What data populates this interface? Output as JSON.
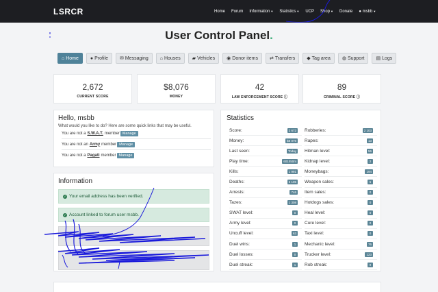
{
  "brand": "LSRCR",
  "nav": {
    "items": [
      {
        "label": "Home",
        "caret": false
      },
      {
        "label": "Forum",
        "caret": false
      },
      {
        "label": "Information",
        "caret": true
      },
      {
        "label": "Statistics",
        "caret": true
      },
      {
        "label": "UCP",
        "caret": false
      },
      {
        "label": "Shop",
        "caret": true
      },
      {
        "label": "Donate",
        "caret": false
      },
      {
        "label": "msbb",
        "caret": true
      }
    ]
  },
  "page_title": "User Control Panel",
  "page_title_dot": ".",
  "tabs": [
    {
      "label": "Home",
      "icon": "home-icon",
      "glyph": "⌂"
    },
    {
      "label": "Profile",
      "icon": "user-icon",
      "glyph": "●"
    },
    {
      "label": "Messaging",
      "icon": "envelope-icon",
      "glyph": "✉"
    },
    {
      "label": "Houses",
      "icon": "house-icon",
      "glyph": "⌂"
    },
    {
      "label": "Vehicles",
      "icon": "car-icon",
      "glyph": "▰"
    },
    {
      "label": "Donor items",
      "icon": "car-side-icon",
      "glyph": "◉"
    },
    {
      "label": "Transfers",
      "icon": "exchange-icon",
      "glyph": "⇄"
    },
    {
      "label": "Tag area",
      "icon": "tag-icon",
      "glyph": "◆"
    },
    {
      "label": "Support",
      "icon": "chat-icon",
      "glyph": "◍"
    },
    {
      "label": "Logs",
      "icon": "file-icon",
      "glyph": "▤"
    }
  ],
  "stat_cards": [
    {
      "value": "2,672",
      "label": "CURRENT SCORE"
    },
    {
      "value": "$8,076",
      "label": "MONEY"
    },
    {
      "value": "42",
      "label": "LAW ENFORCEMENT SCORE ⓘ"
    },
    {
      "value": "89",
      "label": "CRIMINAL SCORE ⓘ"
    }
  ],
  "hello": {
    "heading": "Hello, msbb",
    "subtitle": "What would you like to do? Here are some quick links that may be useful.",
    "members": [
      {
        "prefix": "You are not a",
        "group": "S.W.A.T.",
        "suffix": "member",
        "button": "Manage"
      },
      {
        "prefix": "You are not an",
        "group": "Army",
        "suffix": "member",
        "button": "Manage"
      },
      {
        "prefix": "You are not a",
        "group": "Pagati",
        "suffix": "member",
        "button": "Manage"
      }
    ]
  },
  "information": {
    "heading": "Information",
    "alerts": [
      "Your email address has been verified.",
      "Account linked to forum user msbb."
    ]
  },
  "statistics": {
    "heading": "Statistics",
    "rows": [
      [
        {
          "label": "Score:",
          "value": "2 672"
        },
        {
          "label": "Robberies:",
          "value": "2 103"
        }
      ],
      [
        {
          "label": "Money:",
          "value": "$8 076"
        },
        {
          "label": "Rapes:",
          "value": "13"
        }
      ],
      [
        {
          "label": "Last seen:",
          "value": "Today"
        },
        {
          "label": "Hitman level:",
          "value": "56"
        }
      ],
      [
        {
          "label": "Play time:",
          "value": "601h50m"
        },
        {
          "label": "Kidnap level:",
          "value": "2"
        }
      ],
      [
        {
          "label": "Kills:",
          "value": "1 991"
        },
        {
          "label": "Moneybags:",
          "value": "194"
        }
      ],
      [
        {
          "label": "Deaths:",
          "value": "6 105"
        },
        {
          "label": "Weapon sales:",
          "value": "5"
        }
      ],
      [
        {
          "label": "Arrests:",
          "value": "746"
        },
        {
          "label": "Item sales:",
          "value": "0"
        }
      ],
      [
        {
          "label": "Tazes:",
          "value": "1 308"
        },
        {
          "label": "Hotdogs sales:",
          "value": "0"
        }
      ],
      [
        {
          "label": "SWAT level:",
          "value": "0"
        },
        {
          "label": "Heal level:",
          "value": "0"
        }
      ],
      [
        {
          "label": "Army level:",
          "value": "0"
        },
        {
          "label": "Cure level:",
          "value": "0"
        }
      ],
      [
        {
          "label": "Uncuff level:",
          "value": "63"
        },
        {
          "label": "Taxi level:",
          "value": "0"
        }
      ],
      [
        {
          "label": "Duel wins:",
          "value": "1"
        },
        {
          "label": "Mechanic level:",
          "value": "76"
        }
      ],
      [
        {
          "label": "Duel losses:",
          "value": "0"
        },
        {
          "label": "Trucker level:",
          "value": "123"
        }
      ],
      [
        {
          "label": "Duel streak:",
          "value": "1"
        },
        {
          "label": "Rob streak:",
          "value": "9"
        }
      ]
    ]
  },
  "colors": {
    "navbar": "#1d1e22",
    "accent": "#4f8299",
    "success_bg": "#d6eadf",
    "badge": "#5b8596",
    "title_dot": "#3fae7b",
    "scribble": "#1a1adb"
  }
}
